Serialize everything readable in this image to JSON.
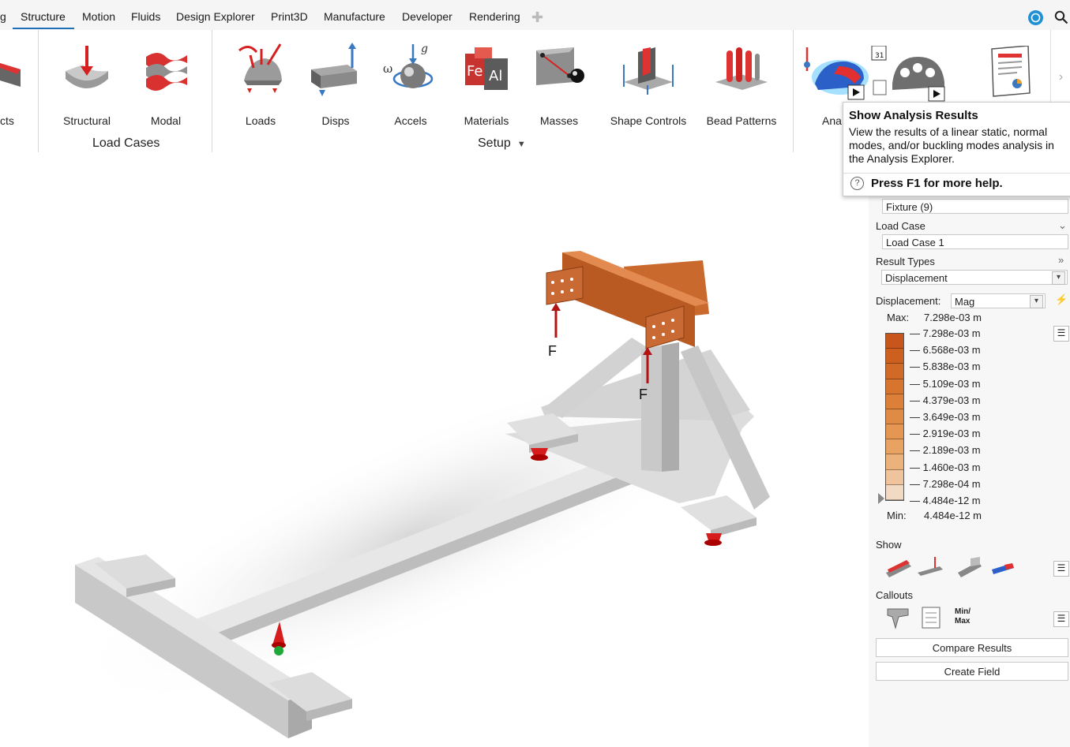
{
  "tabs": [
    {
      "label": "g"
    },
    {
      "label": "Structure"
    },
    {
      "label": "Motion"
    },
    {
      "label": "Fluids"
    },
    {
      "label": "Design Explorer"
    },
    {
      "label": "Print3D"
    },
    {
      "label": "Manufacture"
    },
    {
      "label": "Developer"
    },
    {
      "label": "Rendering"
    }
  ],
  "ribbon": {
    "partial_label": "cts",
    "buttons": [
      {
        "label": "Structural"
      },
      {
        "label": "Modal"
      },
      {
        "label": "Loads"
      },
      {
        "label": "Disps"
      },
      {
        "label": "Accels"
      },
      {
        "label": "Materials"
      },
      {
        "label": "Masses"
      },
      {
        "label": "Shape Controls"
      },
      {
        "label": "Bead Patterns"
      },
      {
        "label": "Ana"
      }
    ],
    "groups": {
      "load_cases": "Load Cases",
      "setup": "Setup"
    },
    "icon_text": {
      "omega": "ω",
      "g": "g",
      "fe": "Fe",
      "al": "Al",
      "day": "31"
    }
  },
  "tooltip": {
    "title": "Show Analysis Results",
    "body": "View the results of a linear static, normal modes, and/or buckling modes analysis in the Analysis Explorer.",
    "help": "Press F1 for more help."
  },
  "panel": {
    "fixture_value": "Fixture (9)",
    "load_case_label": "Load Case",
    "load_case_value": "Load Case 1",
    "result_types_label": "Result Types",
    "result_types_value": "Displacement",
    "displacement_label": "Displacement:",
    "displacement_mode": "Mag",
    "max_label": "Max:",
    "max_value": "7.298e-03 m",
    "min_label": "Min:",
    "min_value": "4.484e-12 m",
    "legend": [
      "7.298e-03 m",
      "6.568e-03 m",
      "5.838e-03 m",
      "5.109e-03 m",
      "4.379e-03 m",
      "3.649e-03 m",
      "2.919e-03 m",
      "2.189e-03 m",
      "1.460e-03 m",
      "7.298e-04 m",
      "4.484e-12 m"
    ],
    "legend_colors": [
      "#c8561c",
      "#cd601f",
      "#d26a27",
      "#d7752f",
      "#dc8039",
      "#e08b45",
      "#e49652",
      "#e8a261",
      "#ecb27c",
      "#efc49c",
      "#f2d9c4"
    ],
    "show_label": "Show",
    "callouts_label": "Callouts",
    "minmax_text": "Min/\nMax",
    "compare_button": "Compare Results",
    "create_field_button": "Create Field"
  },
  "viewport": {
    "force_label": "F"
  }
}
